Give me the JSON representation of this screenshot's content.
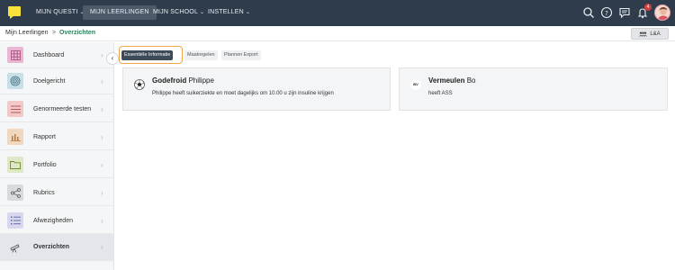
{
  "nav": {
    "items": [
      {
        "label": "MIJN QUESTI",
        "chevron": true,
        "active": false
      },
      {
        "label": "MIJN LEERLINGEN",
        "chevron": false,
        "active": true
      },
      {
        "label": "MIJN SCHOOL",
        "chevron": true,
        "active": false
      },
      {
        "label": "INSTELLEN",
        "chevron": true,
        "active": false
      }
    ],
    "notification_count": "4",
    "icons": [
      "search-icon",
      "help-icon",
      "chat-icon",
      "bell-icon"
    ]
  },
  "breadcrumb": {
    "root": "Mijn Leerlingen",
    "separator": ">",
    "current": "Overzichten"
  },
  "la_button": {
    "label": "L&A"
  },
  "sidebar": {
    "items": [
      {
        "label": "Dashboard",
        "icon": "grid-icon",
        "color": "#e9b7d2"
      },
      {
        "label": "Doelgericht",
        "icon": "target-icon",
        "color": "#c9dfe6"
      },
      {
        "label": "Genormeerde testen",
        "icon": "list-icon",
        "color": "#f2c9c9"
      },
      {
        "label": "Rapport",
        "icon": "bar-chart-icon",
        "color": "#efd8bf"
      },
      {
        "label": "Portfolio",
        "icon": "folder-icon",
        "color": "#dfe8c4"
      },
      {
        "label": "Rubrics",
        "icon": "share-icon",
        "color": "#d9dadb"
      },
      {
        "label": "Afwezigheden",
        "icon": "checklist-icon",
        "color": "#d7d8ee"
      },
      {
        "label": "Overzichten",
        "icon": "telescope-icon",
        "color": "#e3e6ea",
        "active": true
      }
    ]
  },
  "tabs": [
    {
      "label": "Essentiële Informatie",
      "active": true
    },
    {
      "label": "Maatregelen",
      "active": false
    },
    {
      "label": "Plannen Export",
      "active": false
    }
  ],
  "cards": [
    {
      "last_name": "Godefroid",
      "first_name": "Philippe",
      "text": "Philippe heeft suikerziekte en moet dagelijks om 10.00 u zijn insuline krijgen",
      "icon": "football-icon"
    },
    {
      "last_name": "Vermeulen",
      "first_name": "Bo",
      "text": "heeft ASS",
      "initials": "BV"
    }
  ],
  "colors": {
    "topbar": "#2f3c4b",
    "accent_green": "#2e7d5b",
    "tab_ring": "#f0a44a"
  }
}
